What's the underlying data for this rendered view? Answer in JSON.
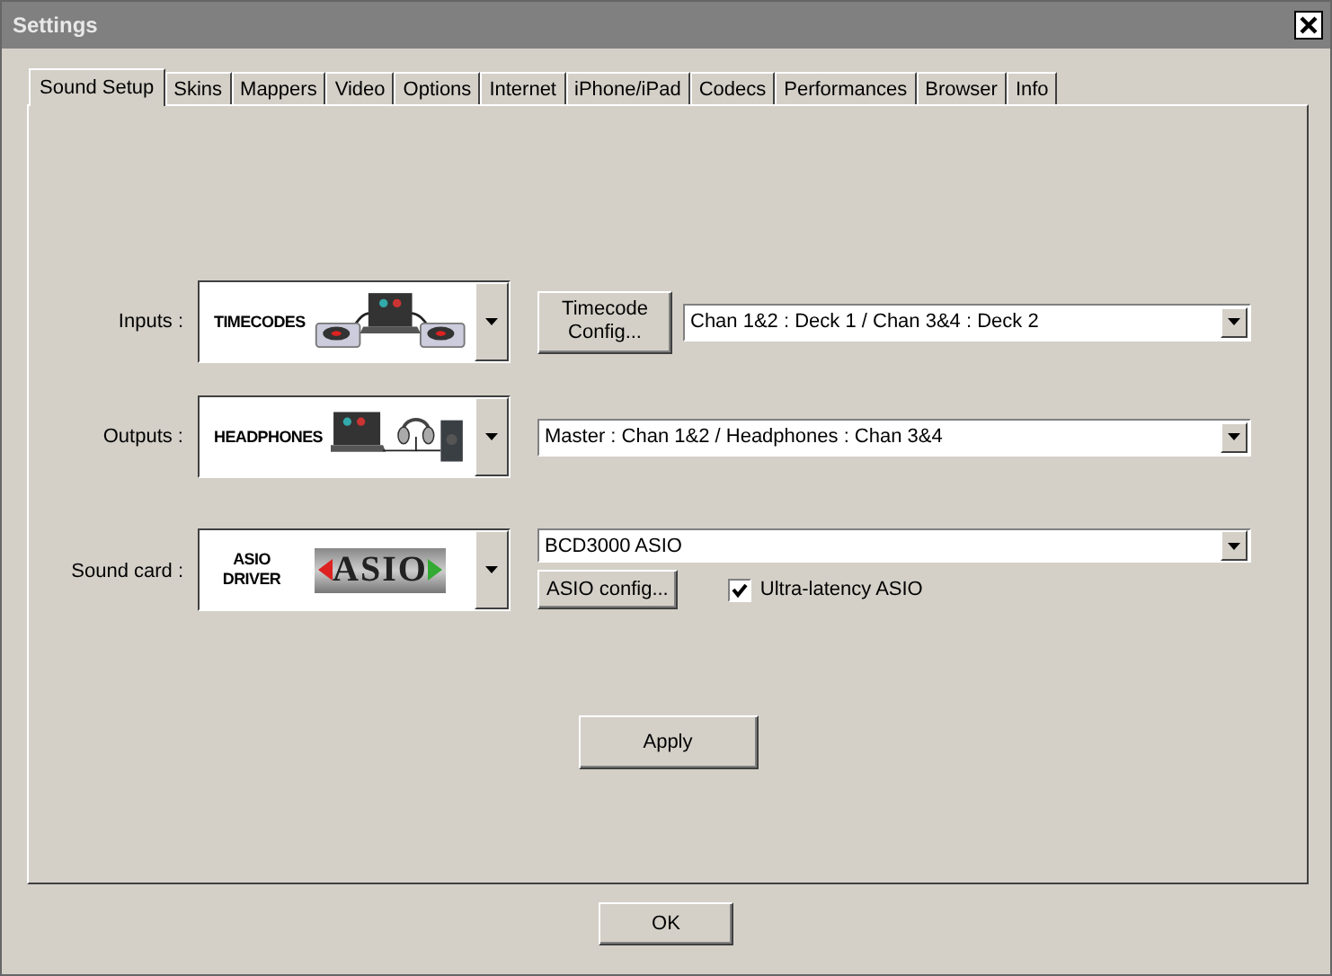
{
  "window": {
    "title": "Settings"
  },
  "tabs": [
    {
      "label": "Sound Setup",
      "selected": true
    },
    {
      "label": "Skins",
      "selected": false
    },
    {
      "label": "Mappers",
      "selected": false
    },
    {
      "label": "Video",
      "selected": false
    },
    {
      "label": "Options",
      "selected": false
    },
    {
      "label": "Internet",
      "selected": false
    },
    {
      "label": "iPhone/iPad",
      "selected": false
    },
    {
      "label": "Codecs",
      "selected": false
    },
    {
      "label": "Performances",
      "selected": false
    },
    {
      "label": "Browser",
      "selected": false
    },
    {
      "label": "Info",
      "selected": false
    }
  ],
  "rows": [
    {
      "label": "Inputs :",
      "tile": {
        "kind": "turntables",
        "text": "TIMECODES"
      },
      "button": "Timecode Config...",
      "dropdown": "Chan 1&2 : Deck 1 / Chan 3&4 : Deck 2"
    },
    {
      "label": "Outputs :",
      "tile": {
        "kind": "headphones",
        "text": "HEADPHONES"
      },
      "dropdown": "Master : Chan 1&2 / Headphones : Chan 3&4"
    },
    {
      "label": "Sound card :",
      "tile": {
        "kind": "asio",
        "text": "ASIO DRIVER",
        "logo": "ASIO"
      },
      "dropdown": "BCD3000 ASIO",
      "button": "ASIO config...",
      "checkbox": {
        "label": "Ultra-latency ASIO",
        "checked": true
      }
    }
  ],
  "apply": "Apply",
  "ok": "OK"
}
